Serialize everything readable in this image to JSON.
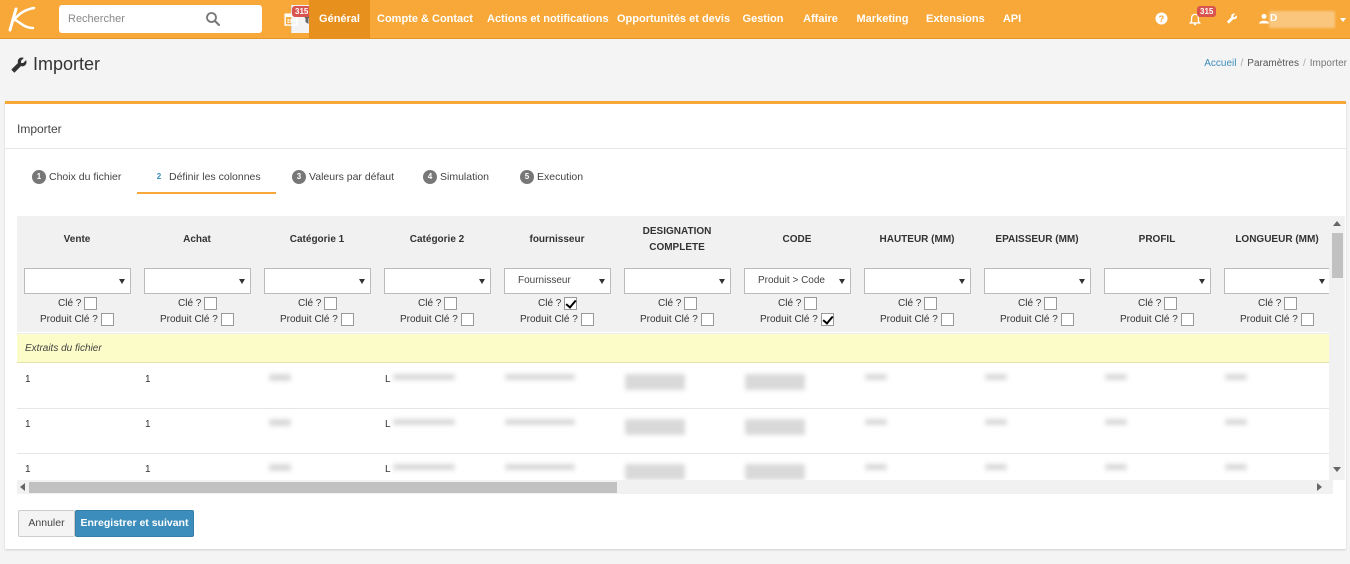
{
  "topbar": {
    "search_placeholder": "Rechercher",
    "calendar_badge": "315",
    "notif_badge": "315",
    "user_initial": "D",
    "nav": [
      "Général",
      "Compte & Contact",
      "Actions et notifications",
      "Opportunités et devis",
      "Gestion",
      "Affaire",
      "Marketing",
      "Extensions",
      "API"
    ],
    "active_nav": "Général"
  },
  "header": {
    "title": "Importer",
    "breadcrumb": [
      "Accueil",
      "Paramètres",
      "Importer"
    ]
  },
  "panel": {
    "title": "Importer",
    "steps": [
      {
        "num": "1",
        "label": "Choix du fichier"
      },
      {
        "num": "2",
        "label": "Définir les colonnes"
      },
      {
        "num": "3",
        "label": "Valeurs par défaut"
      },
      {
        "num": "4",
        "label": "Simulation"
      },
      {
        "num": "5",
        "label": "Execution"
      }
    ],
    "active_step": "2"
  },
  "table": {
    "columns": [
      {
        "header": "Vente",
        "select": "",
        "cle": false,
        "produit_cle": false
      },
      {
        "header": "Achat",
        "select": "",
        "cle": false,
        "produit_cle": false
      },
      {
        "header": "Catégorie 1",
        "select": "",
        "cle": false,
        "produit_cle": false
      },
      {
        "header": "Catégorie 2",
        "select": "",
        "cle": false,
        "produit_cle": false
      },
      {
        "header": "fournisseur",
        "select": "Fournisseur",
        "cle": true,
        "produit_cle": false
      },
      {
        "header": "DESIGNATION COMPLETE",
        "select": "",
        "cle": false,
        "produit_cle": false
      },
      {
        "header": "CODE",
        "select": "Produit > Code",
        "cle": false,
        "produit_cle": true
      },
      {
        "header": "HAUTEUR (MM)",
        "select": "",
        "cle": false,
        "produit_cle": false
      },
      {
        "header": "EPAISSEUR (MM)",
        "select": "",
        "cle": false,
        "produit_cle": false
      },
      {
        "header": "PROFIL",
        "select": "",
        "cle": false,
        "produit_cle": false
      },
      {
        "header": "LONGUEUR (MM)",
        "select": "",
        "cle": false,
        "produit_cle": false
      }
    ],
    "cle_label": "Clé ?",
    "produit_cle_label": "Produit Clé ?",
    "extract_label": "Extraits du fichier",
    "rows": [
      {
        "vente": "1",
        "achat": "1",
        "cat2_initial": "L"
      },
      {
        "vente": "1",
        "achat": "1",
        "cat2_initial": "L"
      },
      {
        "vente": "1",
        "achat": "1",
        "cat2_initial": "L"
      }
    ]
  },
  "buttons": {
    "cancel": "Annuler",
    "save": "Enregistrer et suivant"
  },
  "colors": {
    "brand": "#f7a839",
    "active_nav": "#e8901e",
    "primary": "#3c8dbc",
    "badge": "#d9534f"
  }
}
